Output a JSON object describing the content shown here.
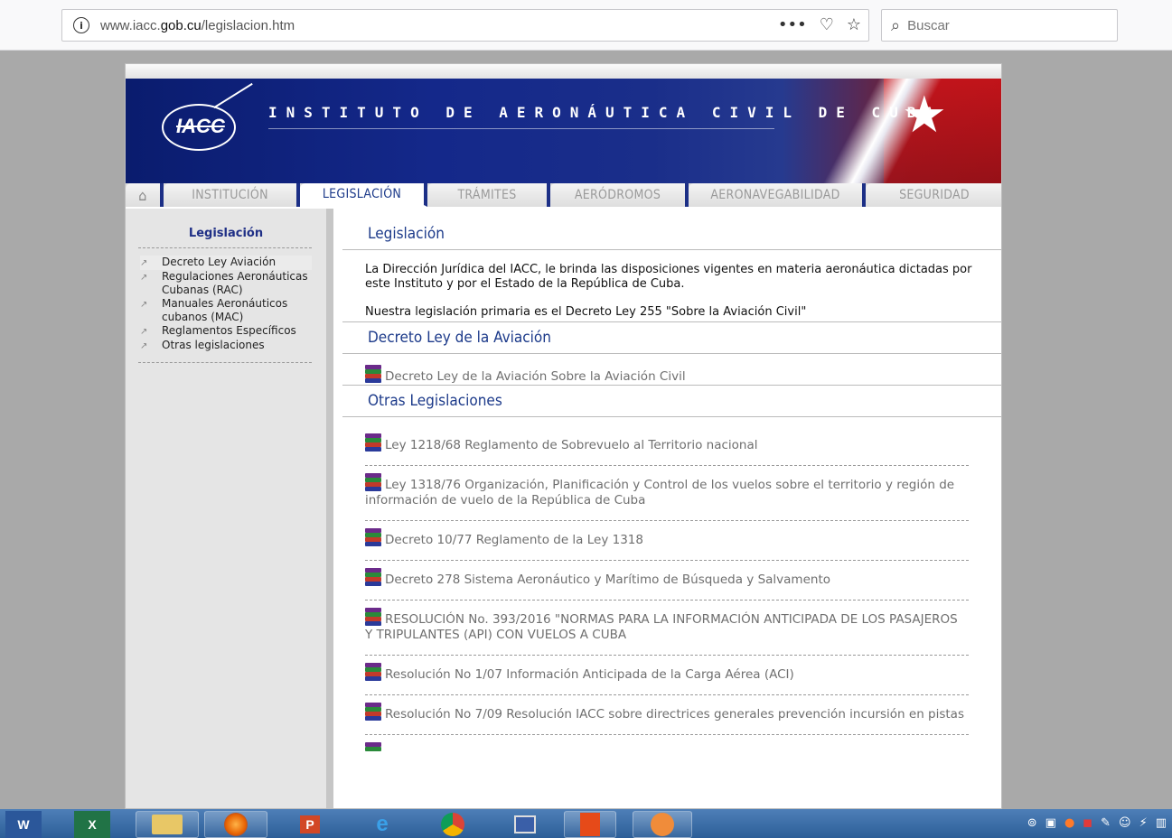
{
  "browser": {
    "url_prefix": "www.iacc.",
    "url_domain": "gob.cu",
    "url_path": "/legislacion.htm",
    "search_placeholder": "Buscar"
  },
  "banner": {
    "title": "INSTITUTO DE AERONÁUTICA CIVIL DE CUBA",
    "logo_text": "IACC"
  },
  "tabs": [
    "INSTITUCIÓN",
    "LEGISLACIÓN",
    "TRÁMITES",
    "AERÓDROMOS",
    "AERONAVEGABILIDAD",
    "SEGURIDAD"
  ],
  "sidebar": {
    "title": "Legislación",
    "items": [
      "Decreto Ley Aviación",
      "Regulaciones Aeronáuticas Cubanas (RAC)",
      "Manuales Aeronáuticos cubanos (MAC)",
      "Reglamentos Específicos",
      "Otras legislaciones"
    ]
  },
  "main": {
    "heading": "Legislación",
    "intro": "La Dirección Jurídica del IACC, le brinda las disposiciones vigentes en materia aeronáutica dictadas por este Instituto y por el Estado de la República de Cuba.",
    "primary": "Nuestra legislación primaria es el Decreto Ley 255 \"Sobre la Aviación Civil\"",
    "decreto_heading": "Decreto Ley de la Aviación",
    "decreto_link": "Decreto Ley de la Aviación Sobre la Aviación Civil",
    "otras_heading": "Otras Legislaciones",
    "otras": [
      "Ley 1218/68 Reglamento de Sobrevuelo al Territorio nacional",
      "Ley 1318/76 Organización, Planificación y Control de los vuelos sobre el territorio y región de información de vuelo de la República de Cuba",
      "Decreto 10/77 Reglamento de la Ley 1318",
      "Decreto 278 Sistema Aeronáutico y Marítimo de Búsqueda y Salvamento",
      "RESOLUCIÓN No. 393/2016 \"NORMAS PARA LA INFORMACIÓN ANTICIPADA DE LOS PASAJEROS Y TRIPULANTES (API) CON VUELOS A CUBA",
      "Resolución No 1/07 Información Anticipada de la Carga Aérea (ACI)",
      "Resolución No 7/09 Resolución IACC sobre directrices generales prevención incursión en pistas"
    ]
  },
  "colors": {
    "accent": "#1c3a8a",
    "link_gray": "#6f6f6f",
    "banner_blue": "#14288a",
    "flag_red": "#c5181c"
  },
  "icons": [
    "info-icon",
    "more-icon",
    "pocket-icon",
    "star-icon",
    "search-icon",
    "home-icon",
    "arrow-icon",
    "books-icon"
  ]
}
